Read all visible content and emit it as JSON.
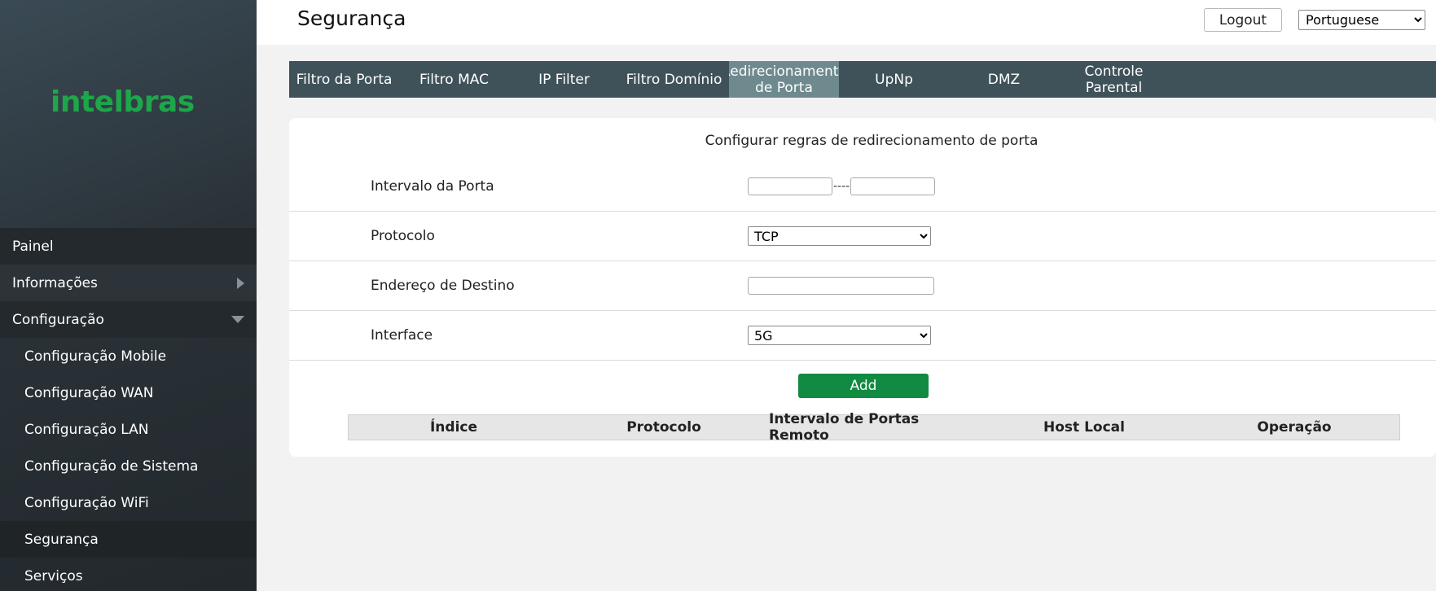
{
  "brand": {
    "logo_text": "intelbras",
    "logo_color": "#1ea64a"
  },
  "sidebar": {
    "items": [
      {
        "label": "Painel"
      },
      {
        "label": "Informações"
      },
      {
        "label": "Configuração"
      },
      {
        "label": "Configuração Mobile"
      },
      {
        "label": "Configuração WAN"
      },
      {
        "label": "Configuração LAN"
      },
      {
        "label": "Configuração de Sistema"
      },
      {
        "label": "Configuração WiFi"
      },
      {
        "label": "Segurança"
      },
      {
        "label": "Serviços"
      }
    ]
  },
  "header": {
    "title": "Segurança",
    "logout_label": "Logout",
    "language": "Portuguese"
  },
  "tabs": [
    {
      "label": "Filtro da Porta"
    },
    {
      "label": "Filtro MAC"
    },
    {
      "label": "IP Filter"
    },
    {
      "label": "Filtro Domínio"
    },
    {
      "label": "Redirecionamento\nde Porta"
    },
    {
      "label": "UpNp"
    },
    {
      "label": "DMZ"
    },
    {
      "label": "Controle\nParental"
    }
  ],
  "form": {
    "title": "Configurar regras de redirecionamento de porta",
    "port_range_label": "Intervalo da Porta",
    "port_range_separator": "----",
    "port_start_value": "",
    "port_end_value": "",
    "protocol_label": "Protocolo",
    "protocol_value": "TCP",
    "destination_label": "Endereço de Destino",
    "destination_value": "",
    "interface_label": "Interface",
    "interface_value": "5G",
    "add_label": "Add",
    "add_color": "#118a42"
  },
  "table": {
    "headers": [
      "Índice",
      "Protocolo",
      "Intervalo de Portas Remoto",
      "Host Local",
      "Operação"
    ]
  }
}
